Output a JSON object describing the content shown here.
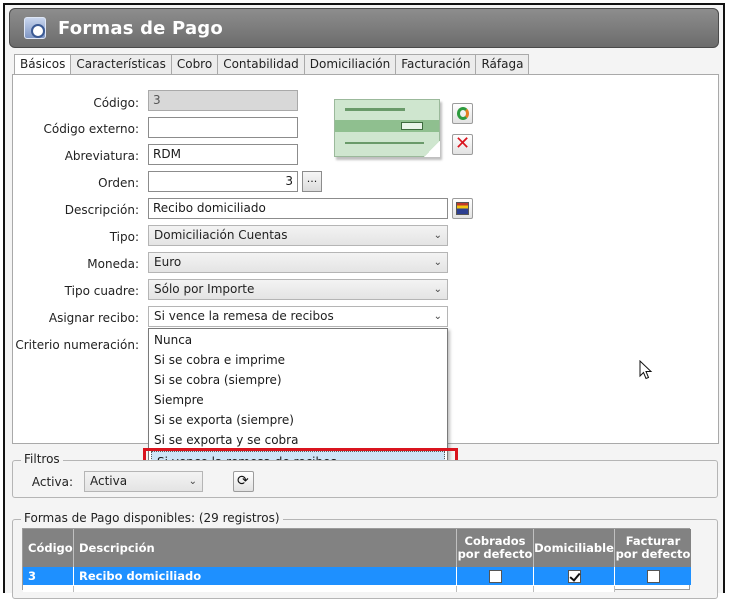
{
  "window": {
    "title": "Formas de Pago"
  },
  "tabs": [
    "Básicos",
    "Características",
    "Cobro",
    "Contabilidad",
    "Domiciliación",
    "Facturación",
    "Ráfaga"
  ],
  "form": {
    "codigo": {
      "label": "Código:",
      "value": "3"
    },
    "codigo_externo": {
      "label": "Código externo:",
      "value": ""
    },
    "abreviatura": {
      "label": "Abreviatura:",
      "value": "RDM"
    },
    "orden": {
      "label": "Orden:",
      "value": "3",
      "button": "..."
    },
    "descripcion": {
      "label": "Descripción:",
      "value": "Recibo domiciliado"
    },
    "tipo": {
      "label": "Tipo:",
      "value": "Domiciliación Cuentas"
    },
    "moneda": {
      "label": "Moneda:",
      "value": "Euro"
    },
    "tipo_cuadre": {
      "label": "Tipo cuadre:",
      "value": "Sólo por Importe"
    },
    "asignar_recibo": {
      "label": "Asignar recibo:",
      "value": "Si vence la remesa de recibos",
      "options": [
        "Nunca",
        "Si se cobra e imprime",
        "Si se cobra (siempre)",
        "Siempre",
        "Si se exporta (siempre)",
        "Si se exporta y se cobra",
        "Si vence la remesa de recibos"
      ]
    },
    "criterio_numeracion": {
      "label": "Criterio numeración:"
    }
  },
  "filters": {
    "legend": "Filtros",
    "activa_label": "Activa:",
    "activa_value": "Activa"
  },
  "list": {
    "legend": "Formas de Pago disponibles:  (29 registros)",
    "columns": {
      "codigo": "Código",
      "descripcion": "Descripción",
      "cobrados": [
        "Cobrados",
        "por defecto"
      ],
      "domiciliable": "Domiciliable",
      "facturar": [
        "Facturar",
        "por defecto"
      ]
    },
    "rows": [
      {
        "codigo": "3",
        "descripcion": "Recibo domiciliado",
        "cobrados": false,
        "domiciliable": true,
        "facturar": false
      }
    ]
  },
  "colors": {
    "accent": "#1e90ff",
    "highlight": "#d9141e",
    "title_bar": "#7a7a7a"
  }
}
